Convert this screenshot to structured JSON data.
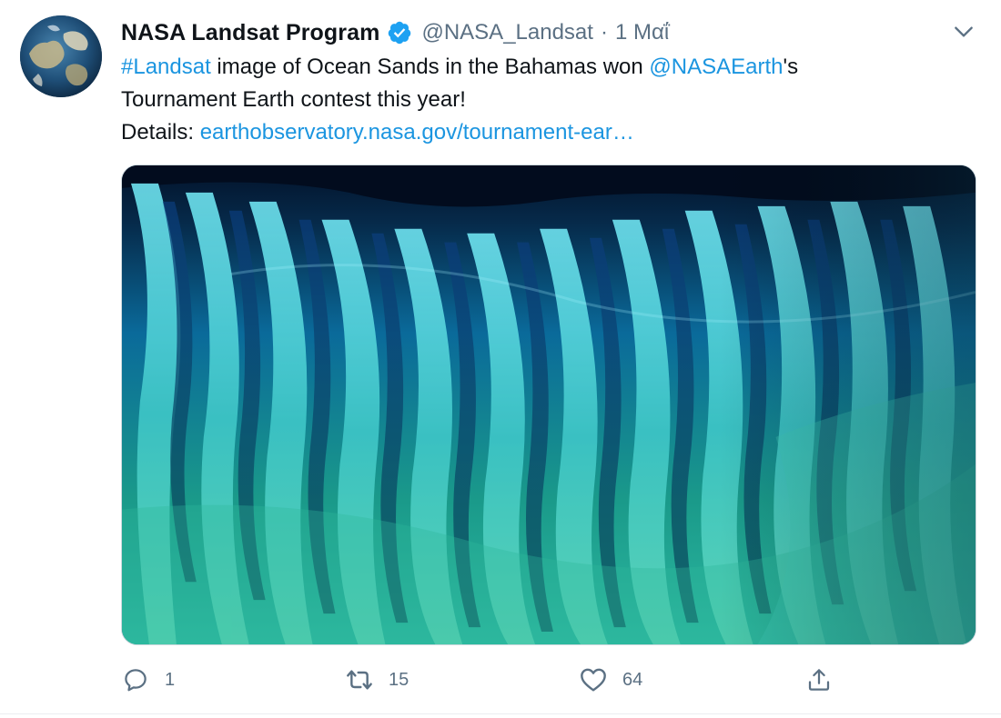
{
  "tweet": {
    "author": {
      "display_name": "NASA Landsat Program",
      "handle": "@NASA_Landsat",
      "separator": "·",
      "time": "1 Μαΐ",
      "verified": true,
      "avatar_icon": "globe-satellite-avatar"
    },
    "text": {
      "line1_hashtag": "#Landsat",
      "line1_text": " image of Ocean Sands in the Bahamas won ",
      "line1_mention": "@NASAEarth",
      "line1_suffix": "'s",
      "line2": "Tournament Earth contest this year!",
      "line3_prefix": "Details: ",
      "line3_link": "earthobservatory.nasa.gov/tournament-ear…"
    },
    "media": {
      "type": "satellite-photo",
      "subject": "turquoise-ocean-sand-ridges"
    },
    "actions": {
      "reply_count": "1",
      "retweet_count": "15",
      "like_count": "64",
      "reply_icon": "reply-icon",
      "retweet_icon": "retweet-icon",
      "like_icon": "heart-icon",
      "share_icon": "share-icon"
    },
    "colors": {
      "link": "#1b95e0",
      "secondary_text": "#5b7083",
      "verified_badge": "#1da1f2"
    }
  }
}
